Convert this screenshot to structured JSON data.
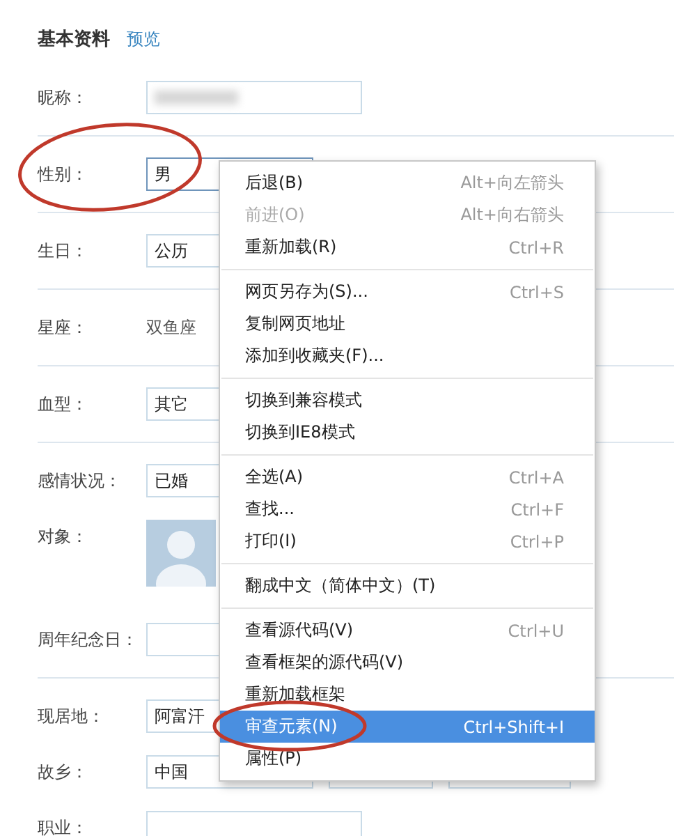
{
  "header": {
    "title": "基本资料",
    "link": "预览"
  },
  "sections": [
    [
      {
        "label": "昵称：",
        "kind": "input",
        "redacted": true
      }
    ],
    [
      {
        "label": "性别：",
        "kind": "select",
        "value": "男",
        "focused": true
      }
    ],
    [
      {
        "label": "生日：",
        "kind": "select",
        "value": "公历"
      }
    ],
    [
      {
        "label": "星座：",
        "kind": "text",
        "value": "双鱼座"
      }
    ],
    [
      {
        "label": "血型：",
        "kind": "select",
        "value": "其它"
      }
    ],
    [
      {
        "label": "感情状况：",
        "kind": "select",
        "value": "已婚"
      },
      {
        "label": "对象："
      },
      {
        "label": "周年纪念日：",
        "kind": "input"
      }
    ],
    [
      {
        "label": "现居地：",
        "kind": "select",
        "value": "阿富汗"
      },
      {
        "label": "故乡：",
        "kind": "selects",
        "value": "中国"
      },
      {
        "label": "职业：",
        "kind": "input"
      }
    ]
  ],
  "context_menu": [
    [
      {
        "label": "后退(B)",
        "shortcut": "Alt+向左箭头",
        "disabled": false,
        "selected": false
      },
      {
        "label": "前进(O)",
        "shortcut": "Alt+向右箭头",
        "disabled": true,
        "selected": false
      },
      {
        "label": "重新加载(R)",
        "shortcut": "Ctrl+R",
        "disabled": false,
        "selected": false
      }
    ],
    [
      {
        "label": "网页另存为(S)...",
        "shortcut": "Ctrl+S",
        "disabled": false,
        "selected": false
      },
      {
        "label": "复制网页地址",
        "disabled": false,
        "selected": false
      },
      {
        "label": "添加到收藏夹(F)...",
        "disabled": false,
        "selected": false
      }
    ],
    [
      {
        "label": "切换到兼容模式",
        "disabled": false,
        "selected": false
      },
      {
        "label": "切换到IE8模式",
        "disabled": false,
        "selected": false
      }
    ],
    [
      {
        "label": "全选(A)",
        "shortcut": "Ctrl+A",
        "disabled": false,
        "selected": false
      },
      {
        "label": "查找...",
        "shortcut": "Ctrl+F",
        "disabled": false,
        "selected": false
      },
      {
        "label": "打印(I)",
        "shortcut": "Ctrl+P",
        "disabled": false,
        "selected": false
      }
    ],
    [
      {
        "label": "翻成中文（简体中文）(T)",
        "disabled": false,
        "selected": false
      }
    ],
    [
      {
        "label": "查看源代码(V)",
        "shortcut": "Ctrl+U",
        "disabled": false,
        "selected": false
      },
      {
        "label": "查看框架的源代码(V)",
        "disabled": false,
        "selected": false
      },
      {
        "label": "重新加载框架",
        "disabled": false,
        "selected": false
      },
      {
        "label": "审查元素(N)",
        "shortcut": "Ctrl+Shift+I",
        "disabled": false,
        "selected": true
      },
      {
        "label": "属性(P)",
        "disabled": false,
        "selected": false
      }
    ]
  ]
}
